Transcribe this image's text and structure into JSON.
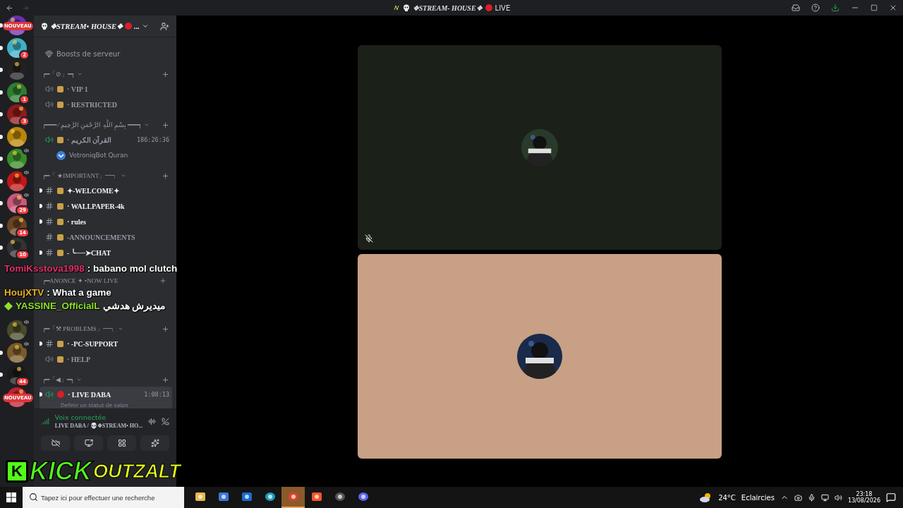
{
  "titlebar": {
    "title": "❖STREAM- HOUSE❖",
    "live": "LIVE"
  },
  "servers_above_chat": [
    {
      "kind": "new",
      "label": "NOUVEAU",
      "unread": true
    },
    {
      "kind": "server",
      "badge": "2",
      "unread": true,
      "voice": false
    },
    {
      "kind": "server",
      "unread": true,
      "voice": false
    },
    {
      "kind": "server",
      "badge": "1",
      "unread": true,
      "voice": false
    },
    {
      "kind": "server",
      "badge": "3",
      "unread": true,
      "voice": false
    },
    {
      "kind": "server",
      "unread": true,
      "voice": false
    },
    {
      "kind": "server",
      "unread": true,
      "voice": true
    },
    {
      "kind": "server",
      "unread": true,
      "voice": true
    },
    {
      "kind": "server",
      "badge": "29",
      "unread": true,
      "voice": true
    },
    {
      "kind": "server",
      "badge": "14",
      "unread": true,
      "voice": false
    },
    {
      "kind": "server",
      "badge": "10",
      "unread": true,
      "voice": false
    }
  ],
  "servers_below_chat": [
    {
      "kind": "server",
      "unread": false,
      "voice": true
    },
    {
      "kind": "server",
      "unread": true,
      "voice": true
    },
    {
      "kind": "server",
      "badge": "44",
      "unread": true,
      "voice": false
    },
    {
      "kind": "new",
      "label": "NOUVEAU",
      "unread": false
    }
  ],
  "server_header": {
    "title": "❖STREAM• HOUSE❖",
    "more": "..."
  },
  "channels_above_chat": [
    {
      "kind": "link",
      "name": "Boosts de serveur"
    },
    {
      "kind": "category",
      "name": "┍━「⊘」━┑"
    },
    {
      "kind": "voice",
      "name": "· VIP 1",
      "unread": false,
      "selected": false,
      "active": false
    },
    {
      "kind": "voice",
      "name": "· RESTRICTED",
      "unread": false,
      "selected": false,
      "active": false
    },
    {
      "kind": "category",
      "name": "┍━━━ ⁄ بِسْمِ اللَّهِ الرَّحْمَنِ الرَّحِيمِ ━━━┑"
    },
    {
      "kind": "voice",
      "name": "· القرآن الكريم",
      "unread": false,
      "selected": false,
      "time": "186:26:36",
      "active": true
    },
    {
      "kind": "user",
      "name": "VetroniqBot Quran"
    },
    {
      "kind": "category",
      "name": "┍━「 ★IMPORTANT」━┑"
    },
    {
      "kind": "text",
      "name": "✦-WELCOME✦",
      "unread": true,
      "selected": false
    },
    {
      "kind": "text",
      "name": "· WALLPAPER-4k",
      "unread": true,
      "selected": false
    },
    {
      "kind": "text",
      "name": "· rules",
      "unread": true,
      "selected": false
    },
    {
      "kind": "text",
      "name": "-ANNOUNCEMENTS",
      "unread": false,
      "selected": false
    },
    {
      "kind": "text",
      "name": "- ╰──➤CHAT",
      "unread": true,
      "selected": false
    }
  ],
  "category_between_chat": {
    "name": "┍━ANONCE ✦ •NOW LIVE"
  },
  "channels_below_chat": [
    {
      "kind": "category",
      "name": "┍━「⚒ PROBLEMS」━┑"
    },
    {
      "kind": "text",
      "name": "· -PC-SUPPORT",
      "unread": true,
      "selected": false
    },
    {
      "kind": "voice",
      "name": "· HELP",
      "unread": false,
      "selected": false,
      "active": false
    },
    {
      "kind": "category",
      "name": "┍━「◀」━┑"
    },
    {
      "kind": "voice",
      "name": "· LIVE DABA",
      "unread": true,
      "selected": true,
      "time": "1:08:13",
      "active": true,
      "status": "Definir un statut de salon"
    }
  ],
  "voice_panel": {
    "status": "Voix connectée",
    "location": "LIVE DABA / 💀❖STREAM• HO..."
  },
  "tiles": [
    {
      "color": "#1b2119",
      "muted": true
    },
    {
      "color": "#c8a085",
      "muted": false
    }
  ],
  "chat": [
    {
      "user": "TomiKsstova1998",
      "color": "#e0306a",
      "text": ": babano mol clutch"
    },
    {
      "user": "HoujXTV",
      "color": "#e8b020",
      "text": ": What a game"
    },
    {
      "user": "YASSINE_OfficialL",
      "color": "#8ee02a",
      "text": "ميديرش هدشي"
    }
  ],
  "logo": {
    "badge": "K",
    "first": "KICK",
    "second": "OUTZALT"
  },
  "taskbar": {
    "search": {
      "placeholder": "Tapez ici pour effectuer une recherche"
    },
    "apps": [
      {
        "selected": false
      },
      {
        "selected": false
      },
      {
        "selected": false
      },
      {
        "selected": false
      },
      {
        "selected": true
      },
      {
        "selected": false
      },
      {
        "selected": false
      },
      {
        "selected": false
      }
    ],
    "temperature": "24°C",
    "weather": "Eclaircies",
    "time": "23:18",
    "date": "13/08/2026"
  }
}
